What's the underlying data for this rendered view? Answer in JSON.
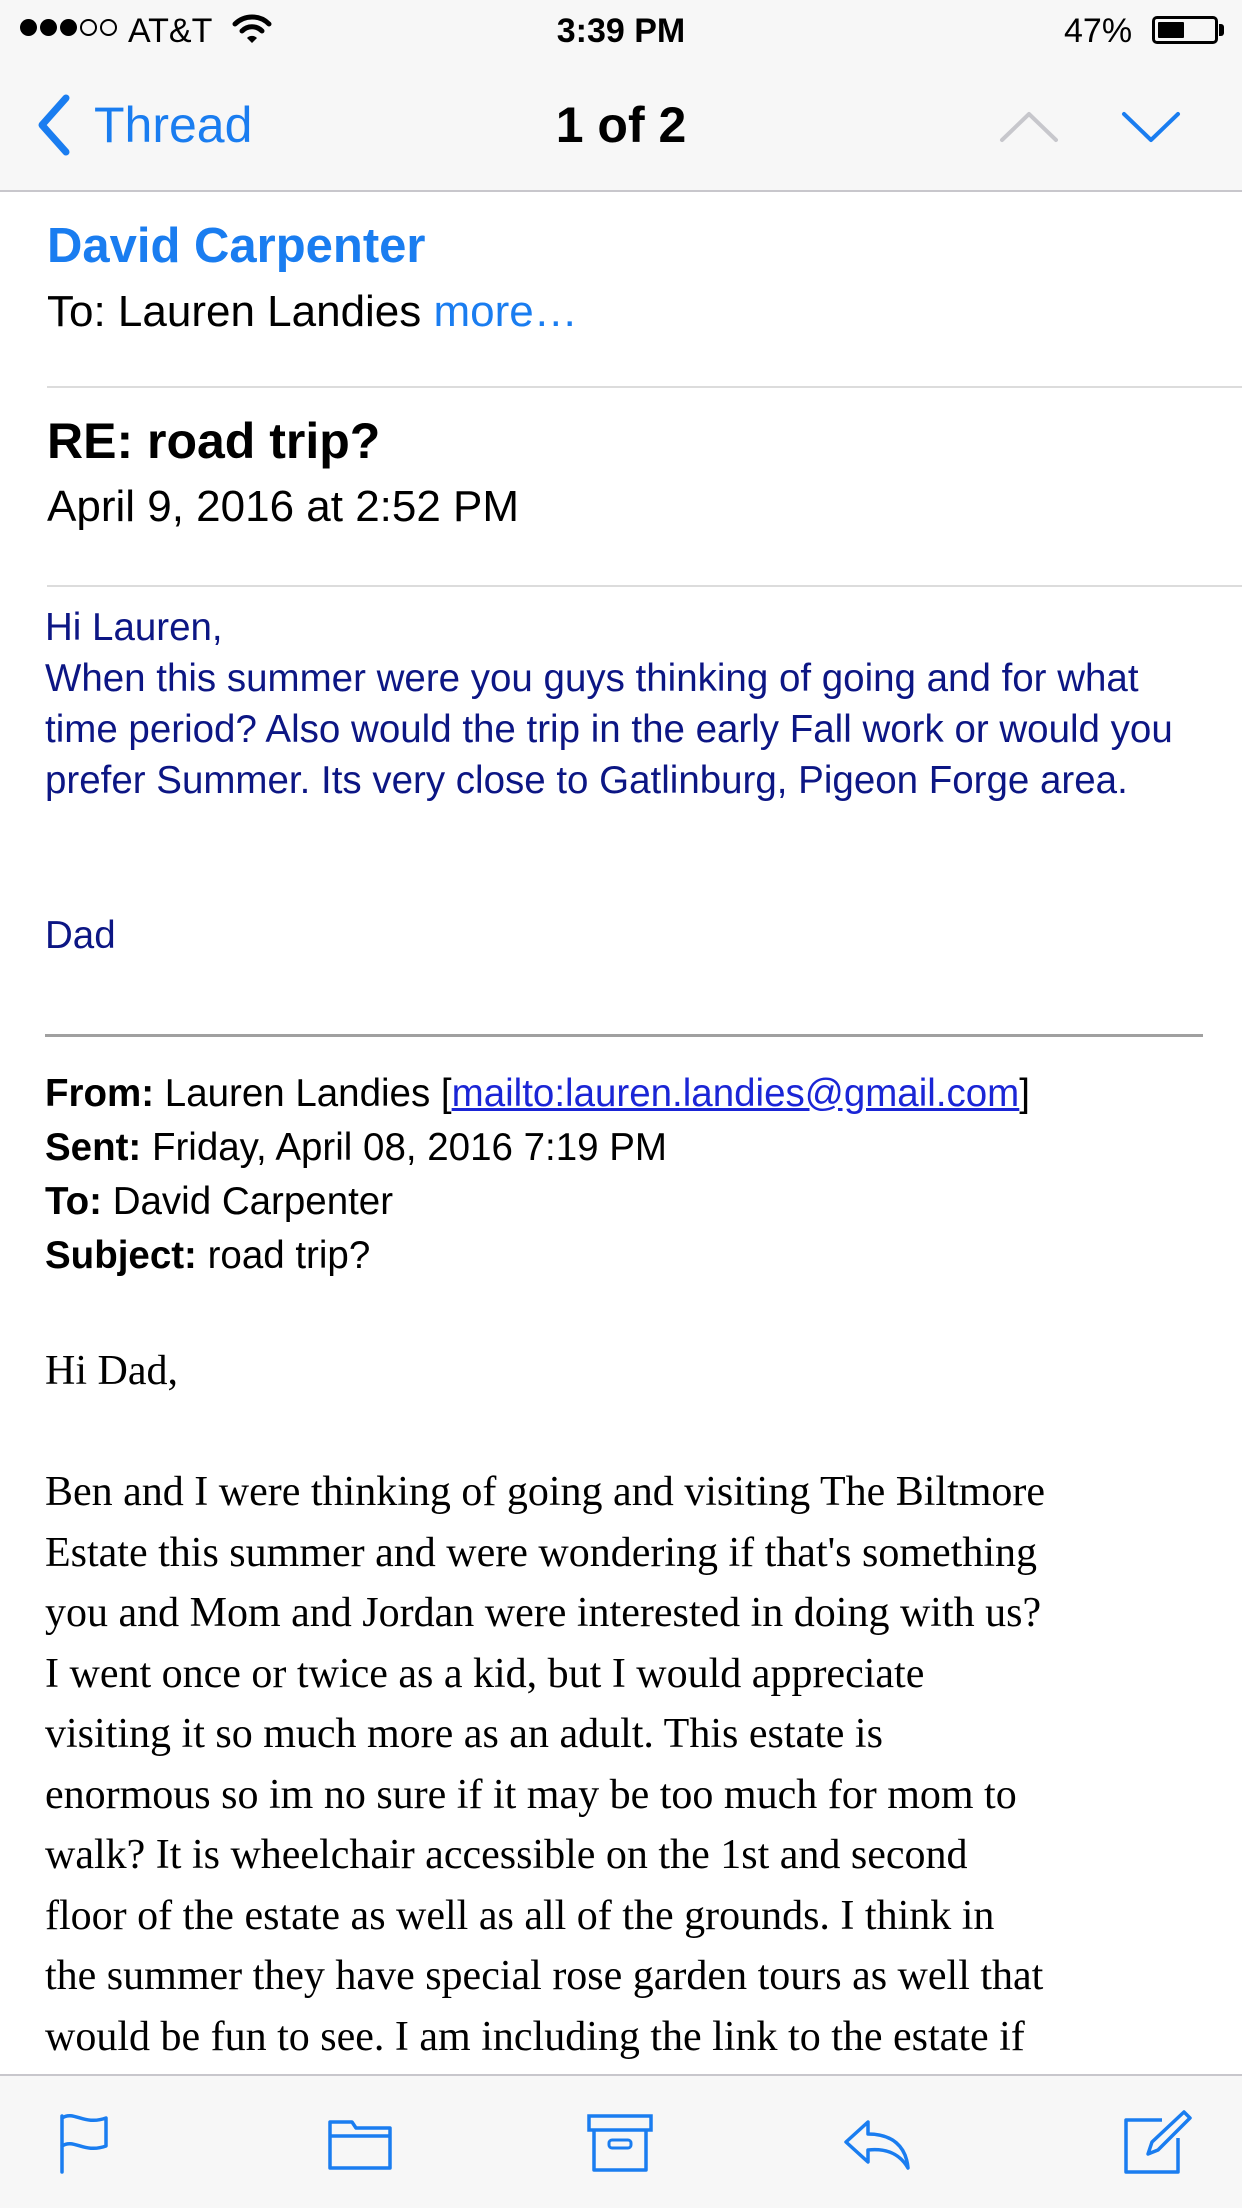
{
  "status_bar": {
    "carrier": "AT&T",
    "time": "3:39 PM",
    "battery_percent": "47%",
    "battery_level": 0.47,
    "signal_bars_filled": 3,
    "signal_bars_total": 5
  },
  "nav": {
    "back_label": "Thread",
    "title": "1 of 2",
    "prev_icon": "chevron-up-icon",
    "next_icon": "chevron-down-icon",
    "accent_color": "#1a7df0"
  },
  "message": {
    "sender": "David Carpenter",
    "to_prefix": "To: Lauren Landies",
    "to_more": "more…",
    "subject": "RE: road trip?",
    "date": "April 9, 2016 at 2:52 PM",
    "body_lines": [
      "Hi Lauren,",
      "When this summer were you guys thinking of going and for what time period? Also would the trip in the early Fall work or would you prefer Summer. Its very close to Gatlinburg, Pigeon Forge area."
    ],
    "signature": "Dad",
    "body_color": "#0c1684"
  },
  "quoted": {
    "from_label": "From:",
    "from_value": "Lauren Landies [",
    "from_mailto": "mailto:lauren.landies@gmail.com",
    "from_close": "]",
    "sent_label": "Sent:",
    "sent_value": "Friday, April 08, 2016 7:19 PM",
    "to_label": "To:",
    "to_value": "David Carpenter",
    "subject_label": "Subject:",
    "subject_value": "road trip?",
    "greeting": "Hi Dad,",
    "body_lines": [
      "Ben and I were thinking of going and visiting The Biltmore",
      "Estate this summer and were wondering if that's something",
      "you and Mom and Jordan were interested in doing with us?",
      "I went once or twice as a kid, but I would appreciate",
      "visiting it so much more as an adult. This estate is",
      "enormous so im no sure if it may be too much for mom to",
      "walk?  It is wheelchair accessible on the 1st and second",
      "floor of the estate as well as all of the grounds. I think in",
      "the summer they have special rose garden tours as well that",
      "would be fun to see. I am including the link to the estate if"
    ]
  },
  "toolbar": {
    "icons": [
      "flag-icon",
      "folder-icon",
      "archive-icon",
      "reply-icon",
      "compose-icon"
    ]
  }
}
